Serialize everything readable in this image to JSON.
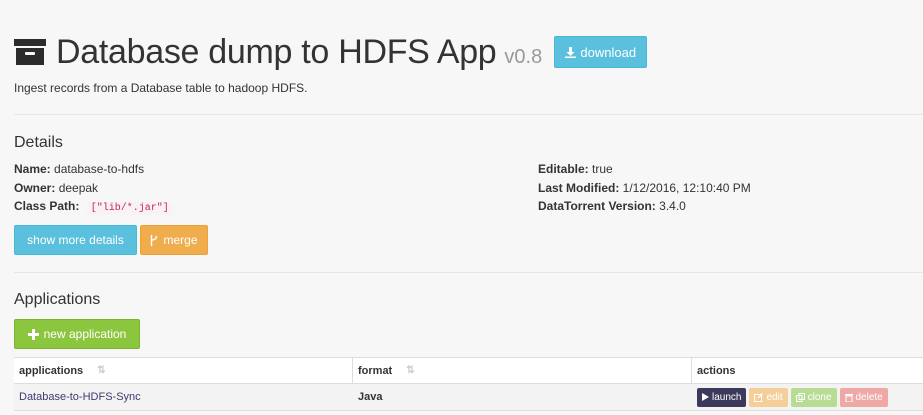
{
  "header": {
    "title": "Database dump to HDFS App",
    "version": "v0.8",
    "download_label": "download",
    "description": "Ingest records from a Database table to hadoop HDFS."
  },
  "details": {
    "heading": "Details",
    "name_label": "Name:",
    "name_value": "database-to-hdfs",
    "owner_label": "Owner:",
    "owner_value": "deepak",
    "classpath_label": "Class Path:",
    "classpath_value": "[\"lib/*.jar\"]",
    "editable_label": "Editable:",
    "editable_value": "true",
    "modified_label": "Last Modified:",
    "modified_value": "1/12/2016, 12:10:40 PM",
    "dtversion_label": "DataTorrent Version:",
    "dtversion_value": "3.4.0",
    "show_more_label": "show more details",
    "merge_label": "merge"
  },
  "applications": {
    "heading": "Applications",
    "new_label": "new application",
    "columns": [
      "applications",
      "format",
      "actions"
    ],
    "rows": [
      {
        "name": "Database-to-HDFS-Sync",
        "format": "Java"
      }
    ],
    "actions": {
      "launch": "launch",
      "edit": "edit",
      "clone": "clone",
      "delete": "delete"
    }
  },
  "colors": {
    "info": "#5bc0de",
    "warning": "#f0ad4e",
    "success": "#8cc63f",
    "launch": "#3b3a5c"
  }
}
